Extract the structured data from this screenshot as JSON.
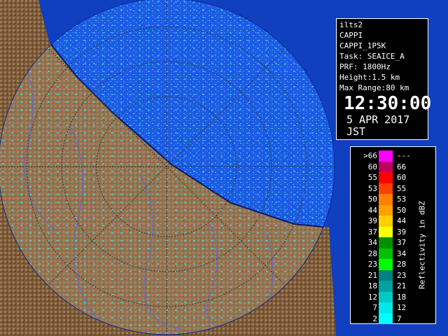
{
  "info": {
    "lines": [
      "ilts2",
      "CAPPI",
      "CAPPI_1P5K",
      "Task: SEAICE_A",
      "PRF: 1800Hz",
      "Height:1.5 km",
      "Max Range:80 km"
    ],
    "time": "12:30:00",
    "date": "5 APR 2017 JST"
  },
  "legend": {
    "unit": "Reflectivity in dBZ",
    "rows": [
      {
        "lo": ">66",
        "hi": "---",
        "color": "#ff00ff"
      },
      {
        "lo": "60",
        "hi": "66",
        "color": "#c00060"
      },
      {
        "lo": "55",
        "hi": "60",
        "color": "#ff0000"
      },
      {
        "lo": "53",
        "hi": "55",
        "color": "#ff4000"
      },
      {
        "lo": "50",
        "hi": "53",
        "color": "#ff8000"
      },
      {
        "lo": "44",
        "hi": "50",
        "color": "#ffa000"
      },
      {
        "lo": "39",
        "hi": "44",
        "color": "#ffd000"
      },
      {
        "lo": "37",
        "hi": "39",
        "color": "#ffff00"
      },
      {
        "lo": "34",
        "hi": "37",
        "color": "#009000"
      },
      {
        "lo": "28",
        "hi": "34",
        "color": "#00c000"
      },
      {
        "lo": "23",
        "hi": "28",
        "color": "#00ff00"
      },
      {
        "lo": "21",
        "hi": "23",
        "color": "#008080"
      },
      {
        "lo": "18",
        "hi": "21",
        "color": "#00a0a0"
      },
      {
        "lo": "12",
        "hi": "18",
        "color": "#00c8c8"
      },
      {
        "lo": "7",
        "hi": "12",
        "color": "#00e8e8"
      },
      {
        "lo": "2",
        "hi": "7",
        "color": "#00ffff"
      }
    ]
  },
  "colors": {
    "sea": "#1e4fd8",
    "land": "#7a5a3a",
    "land_light": "#a8865c",
    "range_disk": "#b8a888",
    "echo": "#40e0f0"
  }
}
